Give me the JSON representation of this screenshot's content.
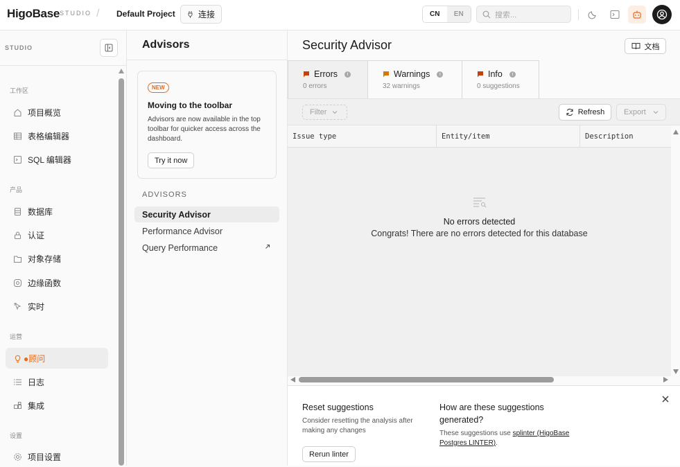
{
  "topbar": {
    "brand": "HigoBase",
    "brand_suffix": "STUDIO",
    "separator": "/",
    "project": "Default Project",
    "connect_label": "连接",
    "lang_cn": "CN",
    "lang_en": "EN",
    "lang_selected": "CN",
    "search_placeholder": "搜索..."
  },
  "sidebar": {
    "header": "STUDIO",
    "sections": [
      {
        "label": "工作区",
        "items": [
          {
            "label": "项目概览",
            "icon": "home-icon"
          },
          {
            "label": "表格编辑器",
            "icon": "table-icon"
          },
          {
            "label": "SQL 编辑器",
            "icon": "terminal-icon"
          }
        ]
      },
      {
        "label": "产品",
        "items": [
          {
            "label": "数据库",
            "icon": "database-icon"
          },
          {
            "label": "认证",
            "icon": "lock-icon"
          },
          {
            "label": "对象存储",
            "icon": "folder-icon"
          },
          {
            "label": "边缘函数",
            "icon": "function-icon"
          },
          {
            "label": "实时",
            "icon": "pointer-icon"
          }
        ]
      },
      {
        "label": "运营",
        "items": [
          {
            "label": "●顾问",
            "icon": "lightbulb-icon",
            "active": true
          },
          {
            "label": "日志",
            "icon": "list-icon"
          },
          {
            "label": "集成",
            "icon": "puzzle-icon"
          }
        ]
      },
      {
        "label": "设置",
        "items": [
          {
            "label": "项目设置",
            "icon": "gear-icon"
          }
        ]
      }
    ]
  },
  "advisors": {
    "title": "Advisors",
    "card": {
      "badge": "NEW",
      "title": "Moving to the toolbar",
      "text": "Advisors are now available in the top toolbar for quicker access across the dashboard.",
      "button": "Try it now"
    },
    "section_label": "ADVISORS",
    "items": [
      {
        "label": "Security Advisor",
        "active": true
      },
      {
        "label": "Performance Advisor"
      },
      {
        "label": "Query Performance",
        "external": true
      }
    ]
  },
  "main": {
    "title": "Security Advisor",
    "docs_label": "文档",
    "tabs": [
      {
        "label": "Errors",
        "sub": "0 errors",
        "active": true
      },
      {
        "label": "Warnings",
        "sub": "32 warnings"
      },
      {
        "label": "Info",
        "sub": "0 suggestions"
      }
    ],
    "filter_label": "Filter",
    "refresh_label": "Refresh",
    "export_label": "Export",
    "columns": [
      "Issue type",
      "Entity/item",
      "Description"
    ],
    "empty_title": "No errors detected",
    "empty_text": "Congrats! There are no errors detected for this database",
    "footer": {
      "reset_title": "Reset suggestions",
      "reset_text": "Consider resetting the analysis after making any changes",
      "rerun_label": "Rerun linter",
      "how_title": "How are these suggestions generated?",
      "how_prefix": "These suggestions use ",
      "how_link": "splinter (HigoBase Postgres LINTER)",
      "how_suffix": "."
    }
  },
  "colors": {
    "accent": "#e26b1d",
    "error_flag": "#c2410c",
    "warning_flag": "#d97706",
    "info_flag": "#c2410c"
  }
}
